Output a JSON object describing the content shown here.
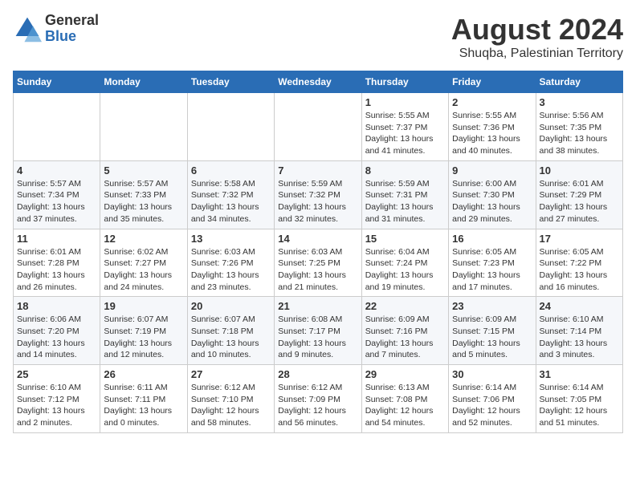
{
  "header": {
    "logo_general": "General",
    "logo_blue": "Blue",
    "month_year": "August 2024",
    "location": "Shuqba, Palestinian Territory"
  },
  "weekdays": [
    "Sunday",
    "Monday",
    "Tuesday",
    "Wednesday",
    "Thursday",
    "Friday",
    "Saturday"
  ],
  "weeks": [
    [
      {
        "day": "",
        "info": ""
      },
      {
        "day": "",
        "info": ""
      },
      {
        "day": "",
        "info": ""
      },
      {
        "day": "",
        "info": ""
      },
      {
        "day": "1",
        "info": "Sunrise: 5:55 AM\nSunset: 7:37 PM\nDaylight: 13 hours\nand 41 minutes."
      },
      {
        "day": "2",
        "info": "Sunrise: 5:55 AM\nSunset: 7:36 PM\nDaylight: 13 hours\nand 40 minutes."
      },
      {
        "day": "3",
        "info": "Sunrise: 5:56 AM\nSunset: 7:35 PM\nDaylight: 13 hours\nand 38 minutes."
      }
    ],
    [
      {
        "day": "4",
        "info": "Sunrise: 5:57 AM\nSunset: 7:34 PM\nDaylight: 13 hours\nand 37 minutes."
      },
      {
        "day": "5",
        "info": "Sunrise: 5:57 AM\nSunset: 7:33 PM\nDaylight: 13 hours\nand 35 minutes."
      },
      {
        "day": "6",
        "info": "Sunrise: 5:58 AM\nSunset: 7:32 PM\nDaylight: 13 hours\nand 34 minutes."
      },
      {
        "day": "7",
        "info": "Sunrise: 5:59 AM\nSunset: 7:32 PM\nDaylight: 13 hours\nand 32 minutes."
      },
      {
        "day": "8",
        "info": "Sunrise: 5:59 AM\nSunset: 7:31 PM\nDaylight: 13 hours\nand 31 minutes."
      },
      {
        "day": "9",
        "info": "Sunrise: 6:00 AM\nSunset: 7:30 PM\nDaylight: 13 hours\nand 29 minutes."
      },
      {
        "day": "10",
        "info": "Sunrise: 6:01 AM\nSunset: 7:29 PM\nDaylight: 13 hours\nand 27 minutes."
      }
    ],
    [
      {
        "day": "11",
        "info": "Sunrise: 6:01 AM\nSunset: 7:28 PM\nDaylight: 13 hours\nand 26 minutes."
      },
      {
        "day": "12",
        "info": "Sunrise: 6:02 AM\nSunset: 7:27 PM\nDaylight: 13 hours\nand 24 minutes."
      },
      {
        "day": "13",
        "info": "Sunrise: 6:03 AM\nSunset: 7:26 PM\nDaylight: 13 hours\nand 23 minutes."
      },
      {
        "day": "14",
        "info": "Sunrise: 6:03 AM\nSunset: 7:25 PM\nDaylight: 13 hours\nand 21 minutes."
      },
      {
        "day": "15",
        "info": "Sunrise: 6:04 AM\nSunset: 7:24 PM\nDaylight: 13 hours\nand 19 minutes."
      },
      {
        "day": "16",
        "info": "Sunrise: 6:05 AM\nSunset: 7:23 PM\nDaylight: 13 hours\nand 17 minutes."
      },
      {
        "day": "17",
        "info": "Sunrise: 6:05 AM\nSunset: 7:22 PM\nDaylight: 13 hours\nand 16 minutes."
      }
    ],
    [
      {
        "day": "18",
        "info": "Sunrise: 6:06 AM\nSunset: 7:20 PM\nDaylight: 13 hours\nand 14 minutes."
      },
      {
        "day": "19",
        "info": "Sunrise: 6:07 AM\nSunset: 7:19 PM\nDaylight: 13 hours\nand 12 minutes."
      },
      {
        "day": "20",
        "info": "Sunrise: 6:07 AM\nSunset: 7:18 PM\nDaylight: 13 hours\nand 10 minutes."
      },
      {
        "day": "21",
        "info": "Sunrise: 6:08 AM\nSunset: 7:17 PM\nDaylight: 13 hours\nand 9 minutes."
      },
      {
        "day": "22",
        "info": "Sunrise: 6:09 AM\nSunset: 7:16 PM\nDaylight: 13 hours\nand 7 minutes."
      },
      {
        "day": "23",
        "info": "Sunrise: 6:09 AM\nSunset: 7:15 PM\nDaylight: 13 hours\nand 5 minutes."
      },
      {
        "day": "24",
        "info": "Sunrise: 6:10 AM\nSunset: 7:14 PM\nDaylight: 13 hours\nand 3 minutes."
      }
    ],
    [
      {
        "day": "25",
        "info": "Sunrise: 6:10 AM\nSunset: 7:12 PM\nDaylight: 13 hours\nand 2 minutes."
      },
      {
        "day": "26",
        "info": "Sunrise: 6:11 AM\nSunset: 7:11 PM\nDaylight: 13 hours\nand 0 minutes."
      },
      {
        "day": "27",
        "info": "Sunrise: 6:12 AM\nSunset: 7:10 PM\nDaylight: 12 hours\nand 58 minutes."
      },
      {
        "day": "28",
        "info": "Sunrise: 6:12 AM\nSunset: 7:09 PM\nDaylight: 12 hours\nand 56 minutes."
      },
      {
        "day": "29",
        "info": "Sunrise: 6:13 AM\nSunset: 7:08 PM\nDaylight: 12 hours\nand 54 minutes."
      },
      {
        "day": "30",
        "info": "Sunrise: 6:14 AM\nSunset: 7:06 PM\nDaylight: 12 hours\nand 52 minutes."
      },
      {
        "day": "31",
        "info": "Sunrise: 6:14 AM\nSunset: 7:05 PM\nDaylight: 12 hours\nand 51 minutes."
      }
    ]
  ]
}
